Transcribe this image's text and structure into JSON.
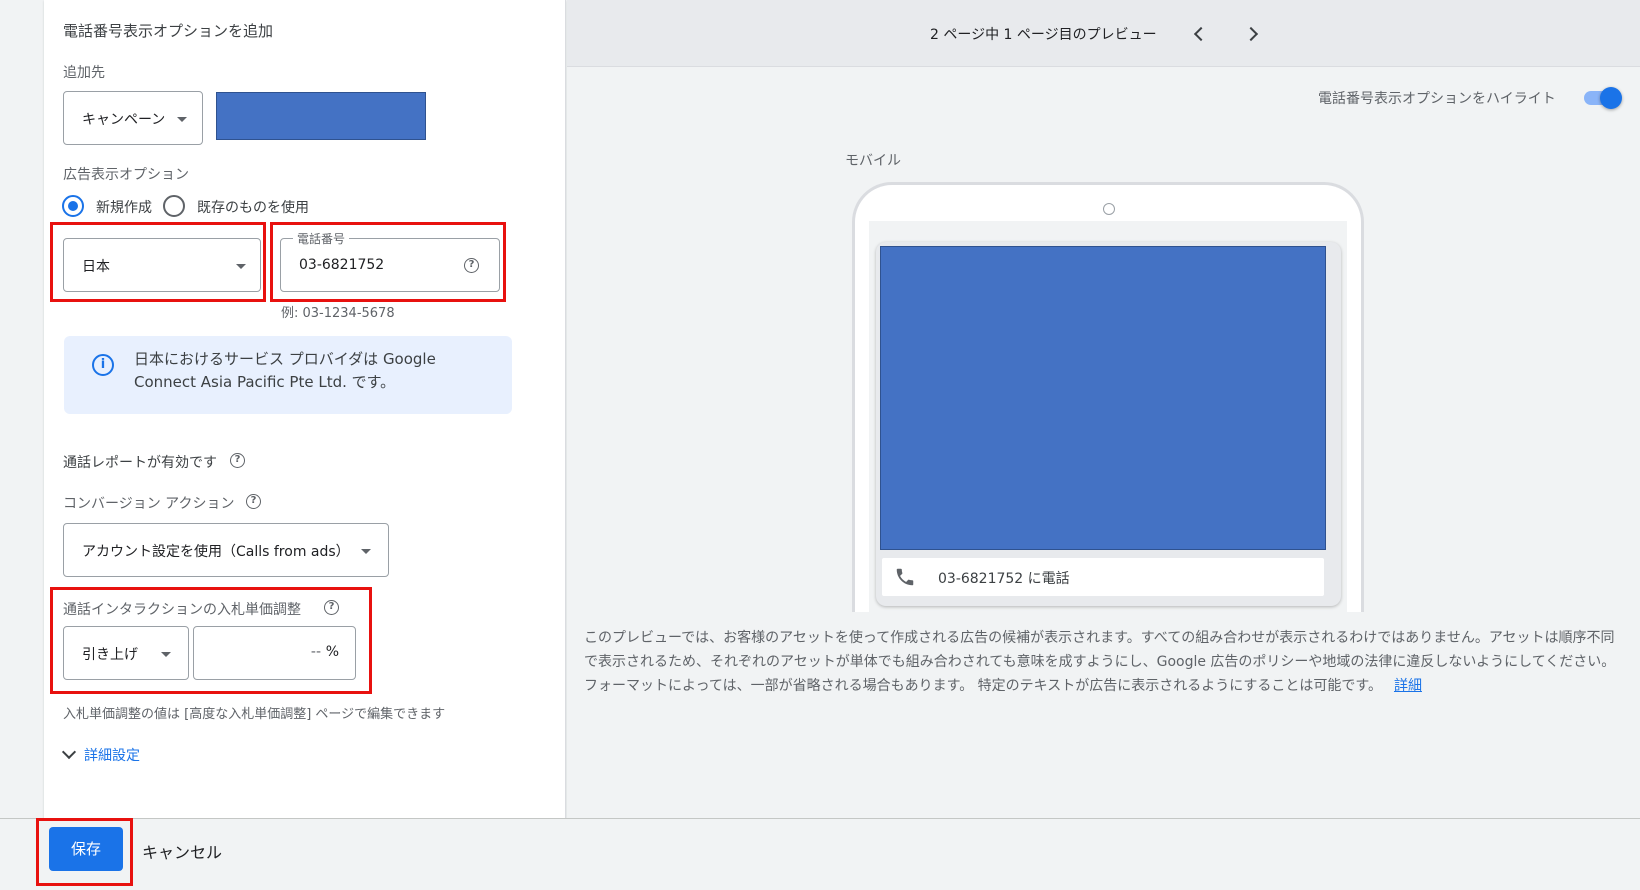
{
  "form": {
    "title": "電話番号表示オプションを追加",
    "add_to_label": "追加先",
    "scope_select": "キャンペーン",
    "ad_extension_label": "広告表示オプション",
    "radio_new": "新規作成",
    "radio_existing": "既存のものを使用",
    "country_select": "日本",
    "phone_field_label": "電話番号",
    "phone_value": "03-6821752",
    "phone_example": "例: 03-1234-5678",
    "info_text": "日本におけるサービス プロバイダは Google Connect Asia Pacific Pte Ltd. です。",
    "call_report_label": "通話レポートが有効です",
    "conversion_label": "コンバージョン アクション",
    "conversion_select": "アカウント設定を使用（Calls from ads）",
    "bid_adjust_label": "通話インタラクションの入札単価調整",
    "bid_direction_select": "引き上げ",
    "bid_value_placeholder": "--",
    "bid_unit": "%",
    "bid_note": "入札単価調整の値は [高度な入札単価調整] ページで編集できます",
    "advanced_link": "詳細設定"
  },
  "preview": {
    "pager_text": "2 ページ中 1 ページ目のプレビュー",
    "highlight_label": "電話番号表示オプションをハイライト",
    "highlight_on": true,
    "device_label": "モバイル",
    "call_text": "03-6821752 に電話",
    "disclaimer": "このプレビューでは、お客様のアセットを使って作成される広告の候補が表示されます。すべての組み合わせが表示されるわけではありません。アセットは順序不同で表示されるため、それぞれのアセットが単体でも組み合わされても意味を成すようにし、Google 広告のポリシーや地域の法律に違反しないようにしてください。フォーマットによっては、一部が省略される場合もあります。 特定のテキストが広告に表示されるようにすることは可能です。",
    "disclaimer_link": "詳細"
  },
  "footer": {
    "save_label": "保存",
    "cancel_label": "キャンセル"
  },
  "colors": {
    "accent": "#1a73e8",
    "redaction_blue": "#4472c4",
    "highlight_red": "#e8110f"
  }
}
